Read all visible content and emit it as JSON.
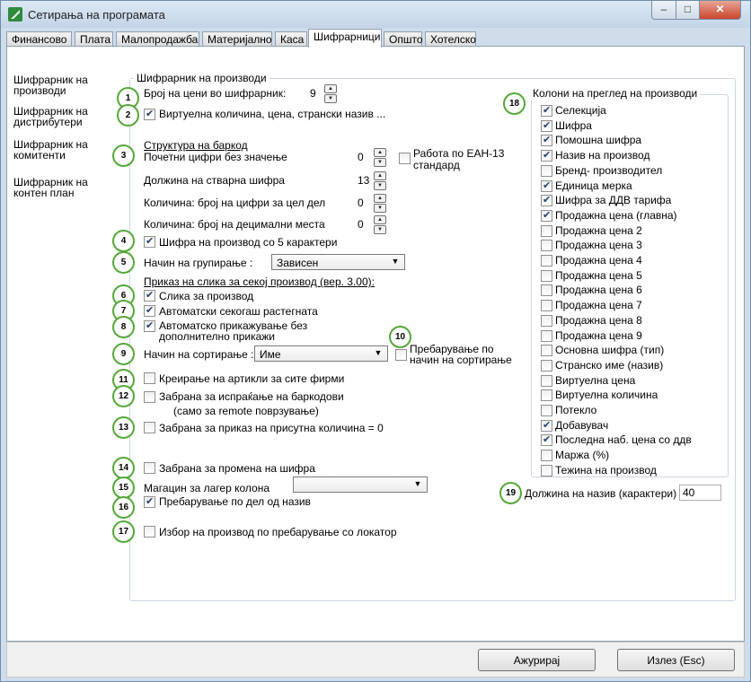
{
  "window": {
    "title": "Сетирања на програмата",
    "min": "–",
    "max": "□",
    "close": "✕"
  },
  "tabs": [
    "Финансово",
    "Плата",
    "Малопродажба",
    "Материјално",
    "Каса",
    "Шифрарници",
    "Општо",
    "Хотелско"
  ],
  "sidebar": [
    "Шифрарник на производи",
    "Шифрарник на дистрибутери",
    "Шифрарник на комитенти",
    "Шифрарник на контен план"
  ],
  "panel_title": "Шифрарник на производи",
  "markers": [
    "1",
    "2",
    "3",
    "4",
    "5",
    "6",
    "7",
    "8",
    "9",
    "10",
    "11",
    "12",
    "13",
    "14",
    "15",
    "16",
    "17",
    "18",
    "19"
  ],
  "settings": {
    "price_count_label": "Број на цени во шифрарник:",
    "price_count_value": "9",
    "virtual_label": "Виртуелна количина, цена, странски назив ...",
    "barcode_header": "Структура на баркод",
    "leading_zeros_label": "Почетни цифри без значење",
    "leading_zeros_value": "0",
    "ean13_label_1": "Работа по ЕАН-13",
    "ean13_label_2": "стандард",
    "real_code_len_label": "Должина на стварна шифра",
    "real_code_len_value": "13",
    "int_digits_label": "Количина: број на цифри за цел дел",
    "int_digits_value": "0",
    "dec_digits_label": "Количина: број на децимални места",
    "dec_digits_value": "0",
    "code5_label": "Шифра на производ со 5 карактери",
    "grouping_label": "Начин на групирање :",
    "grouping_value": "Зависен",
    "image_header": "Приказ на слика за секој производ (вер. 3.00):",
    "product_image_label": "Слика за производ",
    "auto_stretch_label": "Автоматски секогаш растегната",
    "auto_show_label_1": "Автоматско прикажување без",
    "auto_show_label_2": "дополнително прикажи",
    "sort_label": "Начин на сортирање :",
    "sort_value": "Име",
    "search_sort_label_1": "Пребарување по",
    "search_sort_label_2": "начин на сортирање",
    "create_all_label": "Креирање на артикли за сите фирми",
    "barcode_ban_label_1": "Забрана за испраќање на баркодови",
    "barcode_ban_label_2": "(само за  remote поврзување)",
    "zero_qty_label": "Забрана за приказ на присутна количина = 0",
    "code_change_label": "Забрана за промена на шифра",
    "warehouse_label": "Магацин за лагер колона",
    "warehouse_value": "",
    "partial_search_label": "Пребарување по дел од назив",
    "locator_label": "Избор на производ по пребарување со локатор",
    "name_len_label": "Должина на назив (карактери)",
    "name_len_value": "40"
  },
  "checks": {
    "virtual": true,
    "ean13": false,
    "code5": true,
    "product_image": true,
    "auto_stretch": true,
    "auto_show": true,
    "search_sort": false,
    "create_all": false,
    "barcode_ban": false,
    "zero_qty": false,
    "code_change": false,
    "partial_search": true,
    "locator": false
  },
  "columns_title": "Колони на преглед на производи",
  "columns": [
    {
      "label": "Селекција",
      "checked": true
    },
    {
      "label": "Шифра",
      "checked": true
    },
    {
      "label": "Помошна шифра",
      "checked": true
    },
    {
      "label": "Назив на производ",
      "checked": true
    },
    {
      "label": "Бренд- производител",
      "checked": false
    },
    {
      "label": "Единица мерка",
      "checked": true
    },
    {
      "label": "Шифра за ДДВ тарифа",
      "checked": true
    },
    {
      "label": "Продажна цена (главна)",
      "checked": true
    },
    {
      "label": "Продажна цена 2",
      "checked": false
    },
    {
      "label": "Продажна цена 3",
      "checked": false
    },
    {
      "label": "Продажна цена 4",
      "checked": false
    },
    {
      "label": "Продажна цена 5",
      "checked": false
    },
    {
      "label": "Продажна цена 6",
      "checked": false
    },
    {
      "label": "Продажна цена 7",
      "checked": false
    },
    {
      "label": "Продажна цена 8",
      "checked": false
    },
    {
      "label": "Продажна цена 9",
      "checked": false
    },
    {
      "label": "Основна шифра (тип)",
      "checked": false
    },
    {
      "label": "Странско име (назив)",
      "checked": false
    },
    {
      "label": "Виртуелна цена",
      "checked": false
    },
    {
      "label": "Виртуелна количина",
      "checked": false
    },
    {
      "label": "Потекло",
      "checked": false
    },
    {
      "label": "Добавувач",
      "checked": true
    },
    {
      "label": "Последна наб. цена со ддв",
      "checked": true
    },
    {
      "label": "Маржа (%)",
      "checked": false
    },
    {
      "label": "Тежина на производ",
      "checked": false
    }
  ],
  "buttons": {
    "update": "Ажурирај",
    "exit": "Излез (Esc)"
  }
}
